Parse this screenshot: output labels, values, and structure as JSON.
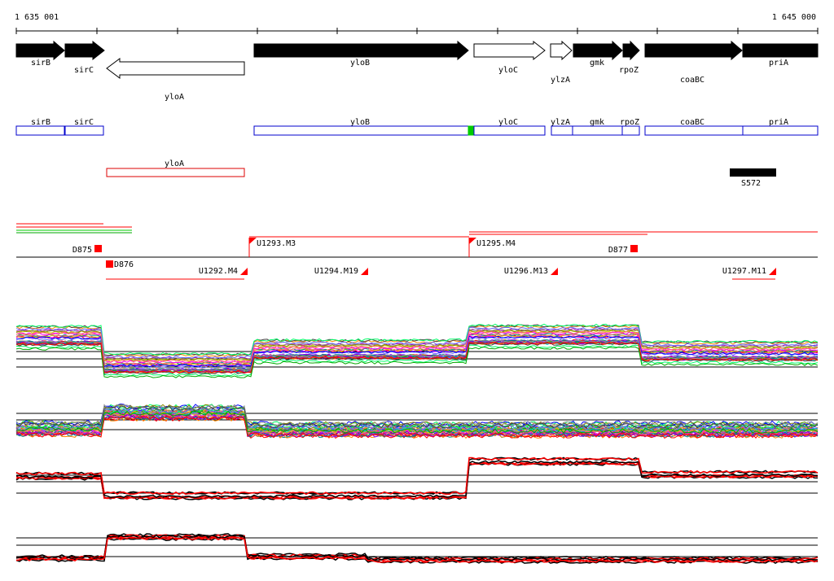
{
  "ruler": {
    "start_label": "1 635 001",
    "end_label": "1 645 000"
  },
  "genes_top": [
    {
      "name": "sirB",
      "strand": "+",
      "fill": "black"
    },
    {
      "name": "sirC",
      "strand": "+",
      "fill": "black"
    },
    {
      "name": "yloA",
      "strand": "-",
      "fill": "white"
    },
    {
      "name": "yloB",
      "strand": "+",
      "fill": "black"
    },
    {
      "name": "yloC",
      "strand": "+",
      "fill": "white"
    },
    {
      "name": "ylzA",
      "strand": "+",
      "fill": "white"
    },
    {
      "name": "gmk",
      "strand": "+",
      "fill": "black"
    },
    {
      "name": "rpoZ",
      "strand": "+",
      "fill": "black"
    },
    {
      "name": "coaBC",
      "strand": "+",
      "fill": "black"
    },
    {
      "name": "priA",
      "strand": "+",
      "fill": "black"
    }
  ],
  "genes_boxes": [
    {
      "name": "sirB",
      "color": "#0000cc"
    },
    {
      "name": "sirC",
      "color": "#0000cc"
    },
    {
      "name": "yloB",
      "color": "#0000cc"
    },
    {
      "name": "yloC",
      "color": "#0000cc"
    },
    {
      "name": "ylzA",
      "color": "#0000cc"
    },
    {
      "name": "gmk",
      "color": "#0000cc"
    },
    {
      "name": "rpoZ",
      "color": "#0000cc"
    },
    {
      "name": "coaBC",
      "color": "#0000cc"
    },
    {
      "name": "priA",
      "color": "#0000cc"
    },
    {
      "name": "yloA",
      "color": "#dd0000"
    }
  ],
  "feature": {
    "name": "S572"
  },
  "markers_above": [
    "D875",
    "U1293.M3",
    "U1295.M4",
    "D877"
  ],
  "markers_below": [
    "D876",
    "U1292.M4",
    "U1294.M19",
    "U1296.M13",
    "U1297.M11"
  ],
  "colors": {
    "accent": "#ff0000",
    "highlight": "#00cc00",
    "box": "#0000cc"
  }
}
